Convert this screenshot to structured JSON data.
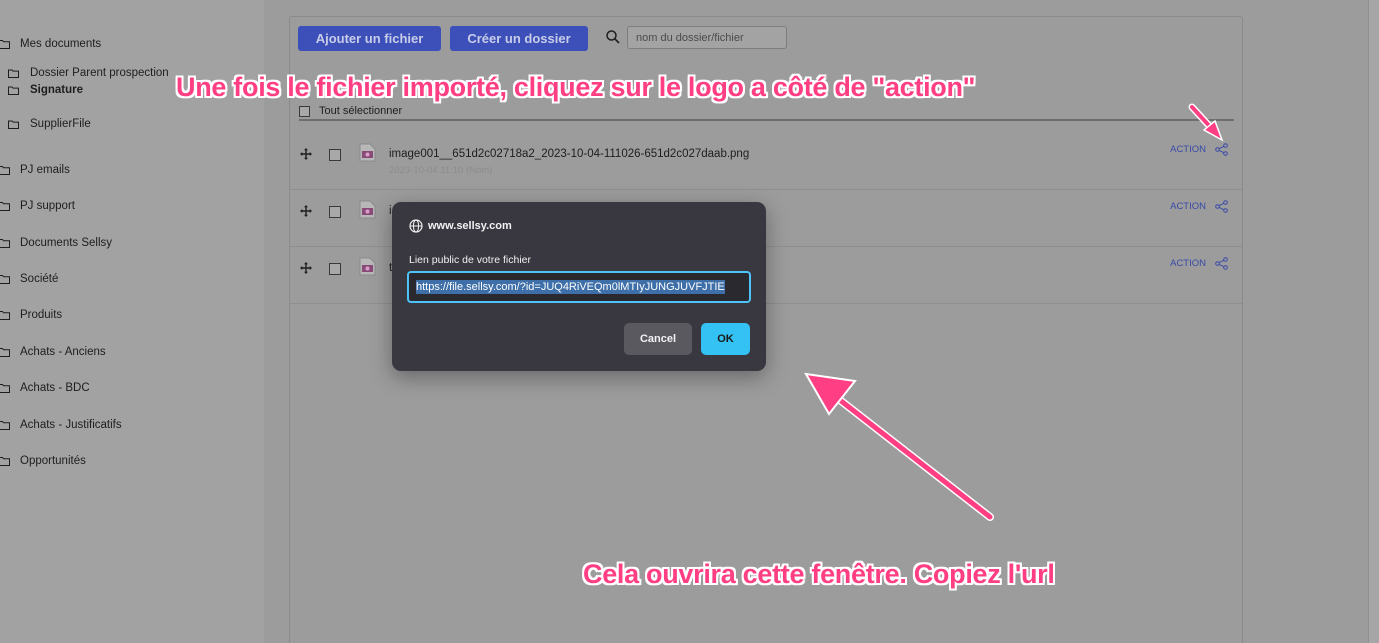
{
  "sidebar": {
    "items": [
      {
        "label": "Mes documents",
        "level": 0,
        "bold": false
      },
      {
        "label": "Dossier Parent prospection",
        "level": 1,
        "bold": false
      },
      {
        "label": "Signature",
        "level": 1,
        "bold": true
      },
      {
        "label": "SupplierFile",
        "level": 1,
        "bold": false
      },
      {
        "label": "PJ emails",
        "level": 0,
        "bold": false
      },
      {
        "label": "PJ support",
        "level": 0,
        "bold": false
      },
      {
        "label": "Documents Sellsy",
        "level": 0,
        "bold": false
      },
      {
        "label": "Société",
        "level": 0,
        "bold": false
      },
      {
        "label": "Produits",
        "level": 0,
        "bold": false
      },
      {
        "label": "Achats - Anciens",
        "level": 0,
        "bold": false
      },
      {
        "label": "Achats - BDC",
        "level": 0,
        "bold": false
      },
      {
        "label": "Achats - Justificatifs",
        "level": 0,
        "bold": false
      },
      {
        "label": "Opportunités",
        "level": 0,
        "bold": false
      }
    ]
  },
  "toolbar": {
    "add_file_label": "Ajouter un fichier",
    "create_folder_label": "Créer un dossier",
    "search_placeholder": "nom du dossier/fichier"
  },
  "file_list": {
    "select_all_label": "Tout sélectionner",
    "action_label": "ACTION",
    "rows": [
      {
        "name": "image001__651d2c02718a2_2023-10-04-111026-651d2c027daab.png",
        "date": "2023-10-04 11:10 (Nom)"
      },
      {
        "name": "i",
        "date": ""
      },
      {
        "name": "t",
        "date": ""
      }
    ]
  },
  "dialog": {
    "origin": "www.sellsy.com",
    "prompt_label": "Lien public de votre fichier",
    "url_value": "https://file.sellsy.com/?id=JUQ4RiVEQm0lMTIyJUNGJUVFJTIE",
    "cancel_label": "Cancel",
    "ok_label": "OK"
  },
  "annotations": {
    "top": "Une fois le fichier importé, cliquez sur le logo a côté de \"action\"",
    "bottom": "Cela ouvrira cette fenêtre. Copiez l'url"
  },
  "colors": {
    "overlay_bg": "#9c9c9c",
    "primary_button": "#3d4fb8",
    "dialog_bg": "#393841",
    "ok_button": "#33c2f3",
    "annotation": "#ff3e83"
  },
  "icons": [
    "folder-icon",
    "search-icon",
    "move-icon",
    "file-image-icon",
    "share-icon",
    "globe-icon",
    "arrow"
  ]
}
